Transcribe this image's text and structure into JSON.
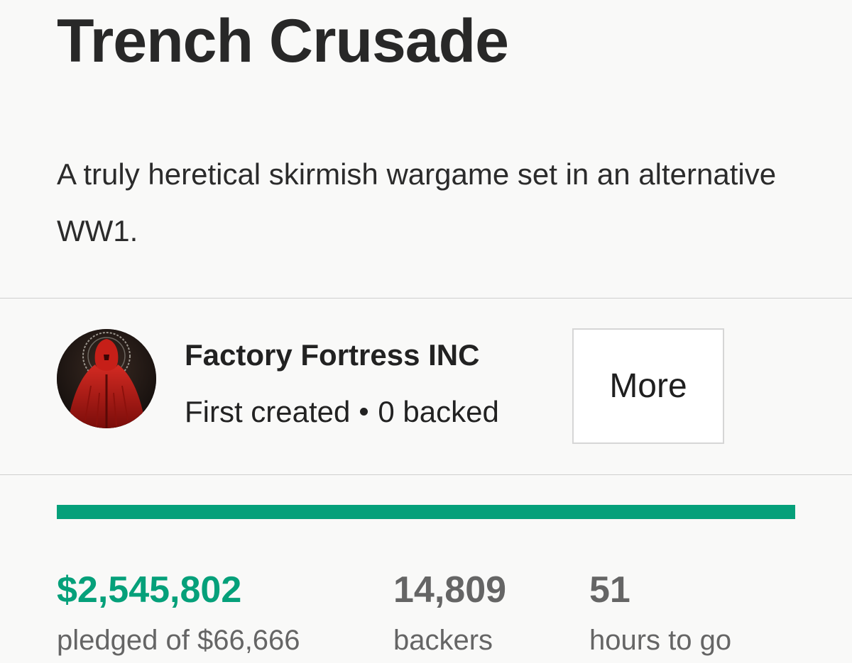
{
  "project": {
    "title": "Trench Crusade",
    "blurb": "A truly heretical skirmish wargame set in an alternative WW1."
  },
  "creator": {
    "name": "Factory Fortress INC",
    "created_text": "First created",
    "backed_text": "0 backed",
    "avatar_icon": "hooded-red-figure-avatar",
    "more_label": "More"
  },
  "funding": {
    "progress_percent": 100,
    "pledged_amount": "$2,545,802",
    "pledged_label": "pledged of $66,666",
    "backers_count": "14,809",
    "backers_label": "backers",
    "time_left": "51",
    "time_left_label": "hours to go"
  },
  "colors": {
    "accent": "#05a07a",
    "muted_text": "#656565",
    "divider": "#cfcfcf"
  }
}
